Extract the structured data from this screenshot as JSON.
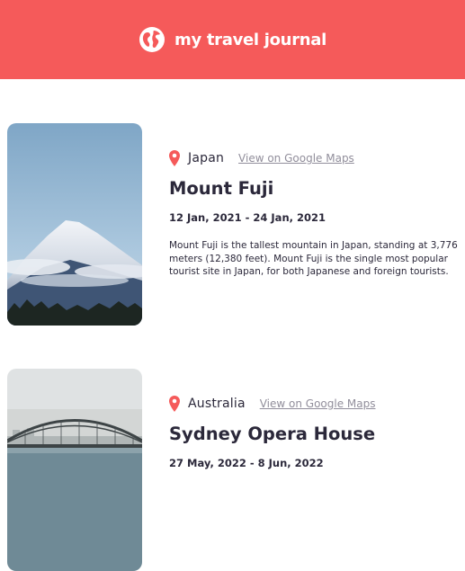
{
  "header": {
    "title": "my travel journal",
    "icon": "globe-icon",
    "background": "#f55a5a"
  },
  "entries": [
    {
      "country": "Japan",
      "maps_link": "View on Google Maps",
      "title": "Mount Fuji",
      "dates": "12 Jan, 2021 - 24 Jan, 2021",
      "description": "Mount Fuji is the tallest mountain in Japan, standing at 3,776 meters (12,380 feet). Mount Fuji is the single most popular tourist site in Japan, for both Japanese and foreign tourists.",
      "pin_color": "#f55a5a"
    },
    {
      "country": "Australia",
      "maps_link": "View on Google Maps",
      "title": "Sydney Opera House",
      "dates": "27 May, 2022 - 8 Jun, 2022",
      "pin_color": "#f55a5a"
    }
  ]
}
